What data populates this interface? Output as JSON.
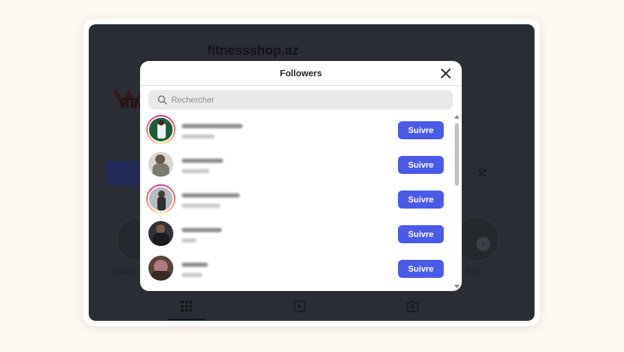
{
  "background": {
    "username": "fitnessshop.az",
    "logo_text": "FITN",
    "highlights": [
      {
        "label": "Optimu"
      },
      {
        "label": "BSN"
      }
    ]
  },
  "modal": {
    "title": "Followers",
    "close_icon": "close-icon",
    "search": {
      "placeholder": "Rechercher",
      "value": "",
      "icon": "search-icon"
    },
    "followers": [
      {
        "has_story_ring": true,
        "avatar_color": "#1d5e3a",
        "follow_label": "Suivre"
      },
      {
        "has_story_ring": false,
        "avatar_color": "#7d7a74",
        "follow_label": "Suivre"
      },
      {
        "has_story_ring": true,
        "avatar_color": "#b6bcc2",
        "follow_label": "Suivre"
      },
      {
        "has_story_ring": false,
        "avatar_color": "#2f3439",
        "follow_label": "Suivre"
      },
      {
        "has_story_ring": false,
        "avatar_color": "#5a4438",
        "follow_label": "Suivre"
      }
    ]
  },
  "colors": {
    "follow_button": "#4a5ae8",
    "overlay": "#2a2d33",
    "story_ring": "#d6249f"
  }
}
